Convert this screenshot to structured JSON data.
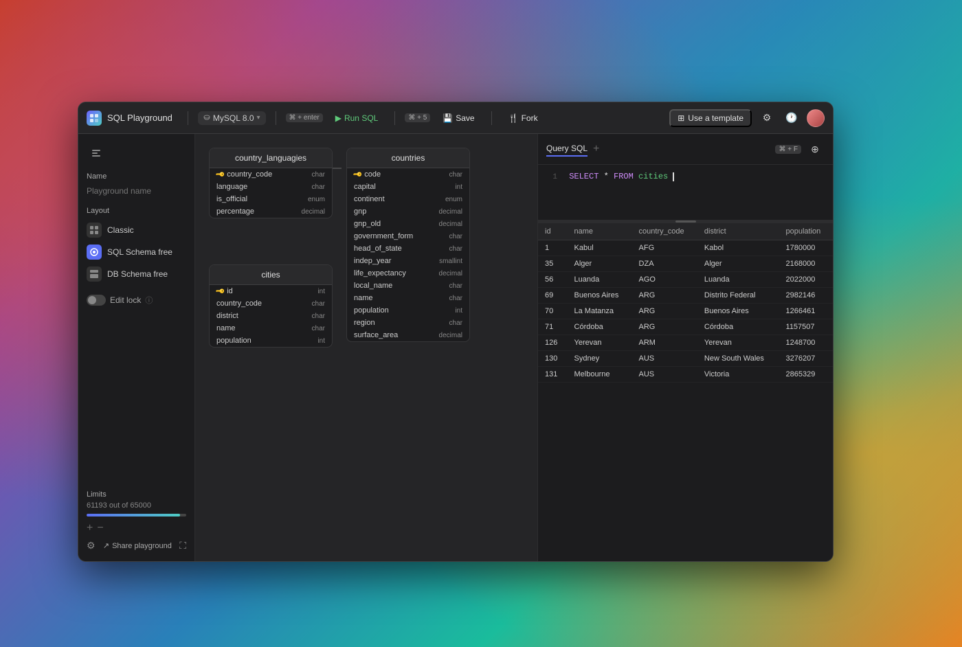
{
  "app": {
    "title": "SQL Playground",
    "icon": "🗃"
  },
  "toolbar": {
    "db_selector": "MySQL 8.0",
    "shortcut_run": "⌘ + enter",
    "btn_run": "Run SQL",
    "shortcut_save": "⌘ + 5",
    "btn_save": "Save",
    "btn_fork": "Fork",
    "btn_template": "Use a template"
  },
  "sidebar": {
    "name_label": "Name",
    "name_placeholder": "Playground name",
    "layout_label": "Layout",
    "layouts": [
      {
        "label": "Classic",
        "icon": "⊞",
        "active": false
      },
      {
        "label": "SQL Schema free",
        "icon": "◈",
        "active": true
      },
      {
        "label": "DB Schema free",
        "icon": "⊟",
        "active": false
      }
    ],
    "edit_lock_label": "Edit lock",
    "limits_label": "Limits",
    "limits_value": "61193 out of 65000",
    "share_label": "Share playground"
  },
  "schema": {
    "tables": [
      {
        "id": "country_languages",
        "title": "country_languagies",
        "columns": [
          {
            "name": "country_code",
            "type": "char",
            "key": true
          },
          {
            "name": "language",
            "type": "char",
            "key": false
          },
          {
            "name": "is_official",
            "type": "enum",
            "key": false
          },
          {
            "name": "percentage",
            "type": "decimal",
            "key": false
          }
        ]
      },
      {
        "id": "countries",
        "title": "countries",
        "columns": [
          {
            "name": "code",
            "type": "char",
            "key": true
          },
          {
            "name": "capital",
            "type": "int",
            "key": false
          },
          {
            "name": "continent",
            "type": "enum",
            "key": false
          },
          {
            "name": "gnp",
            "type": "decimal",
            "key": false
          },
          {
            "name": "gnp_old",
            "type": "decimal",
            "key": false
          },
          {
            "name": "government_form",
            "type": "char",
            "key": false
          },
          {
            "name": "head_of_state",
            "type": "char",
            "key": false
          },
          {
            "name": "indep_year",
            "type": "smallint",
            "key": false
          },
          {
            "name": "life_expectancy",
            "type": "decimal",
            "key": false
          },
          {
            "name": "local_name",
            "type": "char",
            "key": false
          },
          {
            "name": "name",
            "type": "char",
            "key": false
          },
          {
            "name": "population",
            "type": "int",
            "key": false
          },
          {
            "name": "region",
            "type": "char",
            "key": false
          },
          {
            "name": "surface_area",
            "type": "decimal",
            "key": false
          }
        ]
      },
      {
        "id": "cities",
        "title": "cities",
        "columns": [
          {
            "name": "id",
            "type": "int",
            "key": true
          },
          {
            "name": "country_code",
            "type": "char",
            "key": false
          },
          {
            "name": "district",
            "type": "char",
            "key": false
          },
          {
            "name": "name",
            "type": "char",
            "key": false
          },
          {
            "name": "population",
            "type": "int",
            "key": false
          }
        ]
      }
    ]
  },
  "editor": {
    "tab_label": "Query SQL",
    "sql_content": "SELECT * FROM cities",
    "line_number": "1"
  },
  "results": {
    "columns": [
      "id",
      "name",
      "country_code",
      "district",
      "population"
    ],
    "rows": [
      {
        "id": "1",
        "name": "Kabul",
        "country_code": "AFG",
        "district": "Kabol",
        "population": "1780000"
      },
      {
        "id": "35",
        "name": "Alger",
        "country_code": "DZA",
        "district": "Alger",
        "population": "2168000"
      },
      {
        "id": "56",
        "name": "Luanda",
        "country_code": "AGO",
        "district": "Luanda",
        "population": "2022000"
      },
      {
        "id": "69",
        "name": "Buenos Aires",
        "country_code": "ARG",
        "district": "Distrito Federal",
        "population": "2982146"
      },
      {
        "id": "70",
        "name": "La Matanza",
        "country_code": "ARG",
        "district": "Buenos Aires",
        "population": "1266461"
      },
      {
        "id": "71",
        "name": "Córdoba",
        "country_code": "ARG",
        "district": "Córdoba",
        "population": "1157507"
      },
      {
        "id": "126",
        "name": "Yerevan",
        "country_code": "ARM",
        "district": "Yerevan",
        "population": "1248700"
      },
      {
        "id": "130",
        "name": "Sydney",
        "country_code": "AUS",
        "district": "New South Wales",
        "population": "3276207"
      },
      {
        "id": "131",
        "name": "Melbourne",
        "country_code": "AUS",
        "district": "Victoria",
        "population": "2865329"
      }
    ]
  }
}
